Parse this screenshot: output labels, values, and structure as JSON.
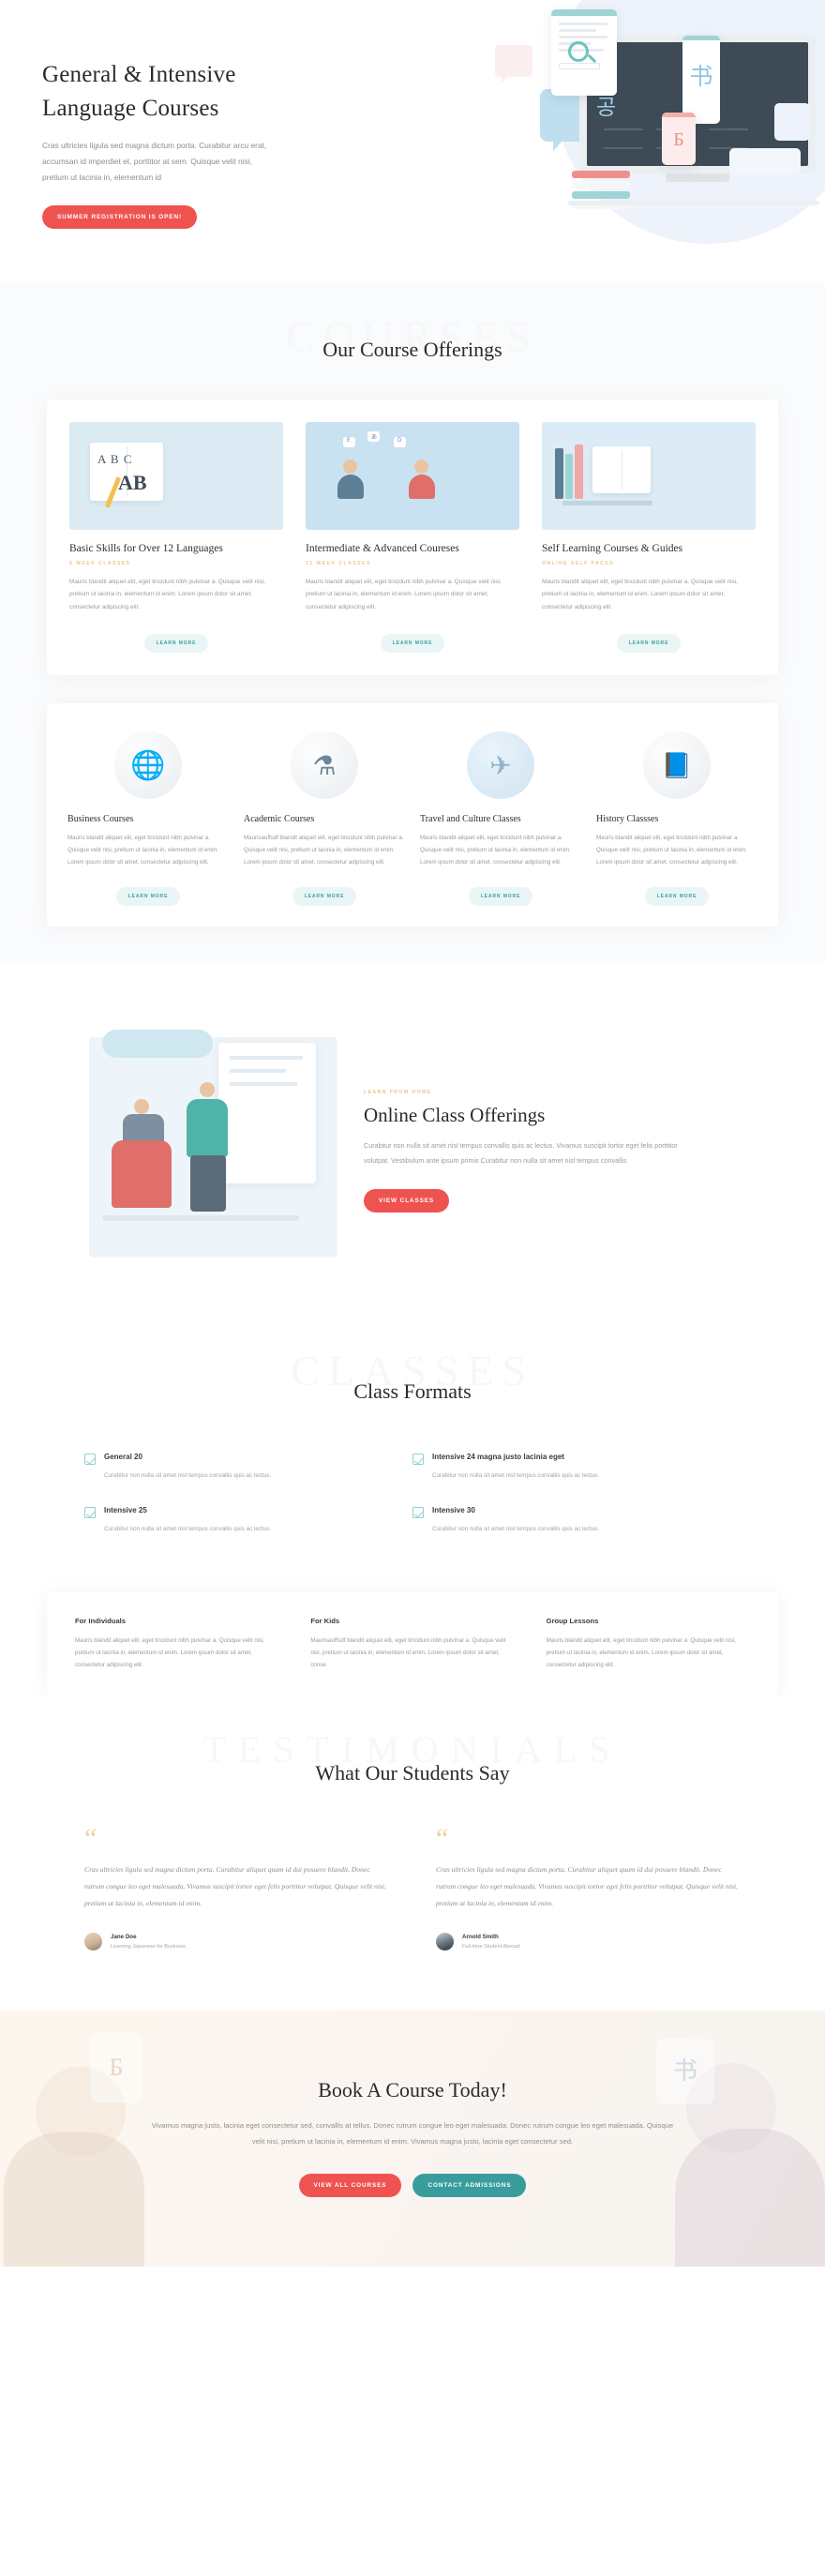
{
  "hero": {
    "title_line1": "General & Intensive",
    "title_line2": "Language Courses",
    "description": "Cras ultricies ligula sed magna dictum porta. Curabitur arcu erat, accumsan id imperdiet et, porttitor at sem. Quisque velit nisi, pretium ut lacinia in, elementum id",
    "cta_label": "SUMMER REGISTRATION IS OPEN!",
    "art": {
      "korean_glyph": "공",
      "chinese_glyph": "书",
      "cyrillic_glyph": "Б"
    }
  },
  "offerings": {
    "watermark": "COURSES",
    "title": "Our Course Offerings",
    "cards": [
      {
        "title": "Basic Skills for Over 12 Languages",
        "eyebrow": "6 WEEK CLASSES",
        "body": "Mauris blandit aliquet elit, eget tincidunt nibh pulvinar a. Quisque velit nisi, pretium ut lacinia in, elementum id enim. Lorem ipsum dolor sit amet, consectetur adipiscing elit.",
        "button": "LEARN MORE",
        "thumb": "open-book-abc-illustration"
      },
      {
        "title": "Intermediate & Advanced Coureses",
        "eyebrow": "12 WEEK CLASSES",
        "body": "Mauris blandit aliquet elit, eget tincidunt nibh pulvinar a. Quisque velit nisi, pretium ut lacinia in, elementum id enim. Lorem ipsum dolor sit amet, consectetur adipiscing elit.",
        "button": "LEARN MORE",
        "thumb": "two-people-speech-bubbles-illustration"
      },
      {
        "title": "Self Learning Courses & Guides",
        "eyebrow": "ONLINE SELF PACED",
        "body": "Mauris blandit aliquet elit, eget tincidunt nibh pulvinar a. Quisque velit nisi, pretium ut lacinia in, elementum id enim. Lorem ipsum dolor sit amet, consectetur adipiscing elit.",
        "button": "LEARN MORE",
        "thumb": "books-and-open-book-illustration"
      }
    ],
    "categories": [
      {
        "title": "Business  Courses",
        "body": "Mauris blandit aliquet elit, eget tincidunt nibh pulvinar a. Quisque velit nisi, pretium ut lacinia in, elementum id enim. Lorem ipsum dolor sit amet, consectetur adipiscing elit.",
        "button": "LEARN MORE",
        "icon": "globe-icon",
        "icon_glyph": "🌐"
      },
      {
        "title": "Academic Courses",
        "body": "Maurisauffsdf blandit aliquet elit, eget tincidunt nibh pulvinar a. Quisque velit nisi, pretium ut lacinia in, elementum id enim. Lorem ipsum dolor sit amet, consectetur adipiscing elit.",
        "button": "LEARN MORE",
        "icon": "flask-pencil-icon",
        "icon_glyph": "⚗"
      },
      {
        "title": "Travel and Culture Classes",
        "body": "Mauris blandit aliquet elit, eget tincidunt nibh pulvinar a. Quisque velit nisi, pretium ut lacinia in, elementum id enim. Lorem ipsum dolor sit amet, consectetur adipiscing elit.",
        "button": "LEARN MORE",
        "icon": "airplane-icon",
        "icon_glyph": "✈"
      },
      {
        "title": "History Classses",
        "body": "Mauris blandit aliquet elit, eget tincidunt nibh pulvinar a. Quisque velit nisi, pretium ut lacinia in, elementum id enim. Lorem ipsum dolor sit amet, consectetur adipiscing elit.",
        "button": "LEARN MORE",
        "icon": "book-magnifier-icon",
        "icon_glyph": "📘"
      }
    ]
  },
  "online": {
    "eyebrow": "LEARN FROM HOME",
    "title": "Online Class Offerings",
    "body": "Curabitur non nulla sit amet nisl tempus convallis quis ac lectus. Vivamus suscipit tortor eget felis porttitor volutpat. Vestibulum ante ipsum primis Curabitur non nulla sit amet nisl tempus convallis",
    "cta_label": "VIEW CLASSES",
    "art": "teacher-and-student-whiteboard-illustration"
  },
  "formats": {
    "watermark": "CLASSES",
    "title": "Class Formats",
    "items": [
      {
        "name": "General 20",
        "desc": "Curabitur non nulla sit amet nisl tempus convallis quis ac lectus."
      },
      {
        "name": "Intensive 24 magna justo lacinia eget",
        "desc": "Curabitur non nulla sit amet nisl tempus convallis quis ac lectus."
      },
      {
        "name": "Intensive 25",
        "desc": "Curabitur non nulla sit amet nisl tempus convallis quis ac lectus."
      },
      {
        "name": "Intensive 30",
        "desc": "Curabitur non nulla sit amet nisl tempus convallis quis ac lectus."
      }
    ],
    "audiences": [
      {
        "title": "For Individuals",
        "body": "Mauris blandit aliquet elit, eget tincidunt nibh pulvinar a. Quisque velit nisi, pretium ut lacinia in, elementum id enim. Lorem ipsum dolor sit amet, consectetur adipiscing elit."
      },
      {
        "title": "For Kids",
        "body": "Maurisauffsdf blandit aliquet elit, eget tincidunt nibh pulvinar a. Quisque velit nisi, pretium ut lacinia in, elementum id enim. Lorem ipsum dolor sit amet, conse"
      },
      {
        "title": "Group Lessons",
        "body": "Mauris blandit aliquet elit, eget tincidunt nibh pulvinar a. Quisque velit nisi, pretium ut lacinia in, elementum id enim. Lorem ipsum dolor sit amet, consectetur adipiscing elit."
      }
    ]
  },
  "testimonials": {
    "watermark": "TESTIMONIALS",
    "title": "What Our Students Say",
    "items": [
      {
        "quote_mark": "“",
        "quote": "Cras ultricies ligula sed magna dictum porta. Curabitur aliquet quam id dui posuere blandit. Donec rutrum congue leo eget malesuada. Vivamus suscipit tortor eget felis porttitor volutpat. Quisque velit nisi, pretium ut lacinia in, elementum id enim.",
        "name": "Jane Doe",
        "role": "Learning Japanese for Business"
      },
      {
        "quote_mark": "“",
        "quote": "Cras ultricies ligula sed magna dictum porta. Curabitur aliquet quam id dui posuere blandit. Donec rutrum congue leo eget malesuada. Vivamus suscipit tortor eget felis porttitor volutpat. Quisque velit nisi, pretium ut lacinia in, elementum id enim.",
        "name": "Arnold Smith",
        "role": "Full-time Student Abroad"
      }
    ]
  },
  "cta": {
    "title": "Book A Course Today!",
    "body": "Vivamus magna justo, lacinia eget consectetur sed, convallis at tellus. Donec rutrum congue leo eget malesuada. Donec rutrum congue leo eget malesuada. Quisque velit nisi, pretium ut lacinia in, elementum id enim. Vivamus magna justo, lacinia eget consectetur sed.",
    "primary_label": "VIEW ALL COURSES",
    "secondary_label": "CONTACT ADMISSIONS",
    "ghost_glyph_left": "Б",
    "ghost_glyph_right": "书"
  },
  "colors": {
    "red": "#ef5350",
    "teal": "#3a9d9d",
    "ghost_teal_bg": "#eaf6f6",
    "gold": "#e8c98f",
    "dark": "#2b2b2b"
  }
}
